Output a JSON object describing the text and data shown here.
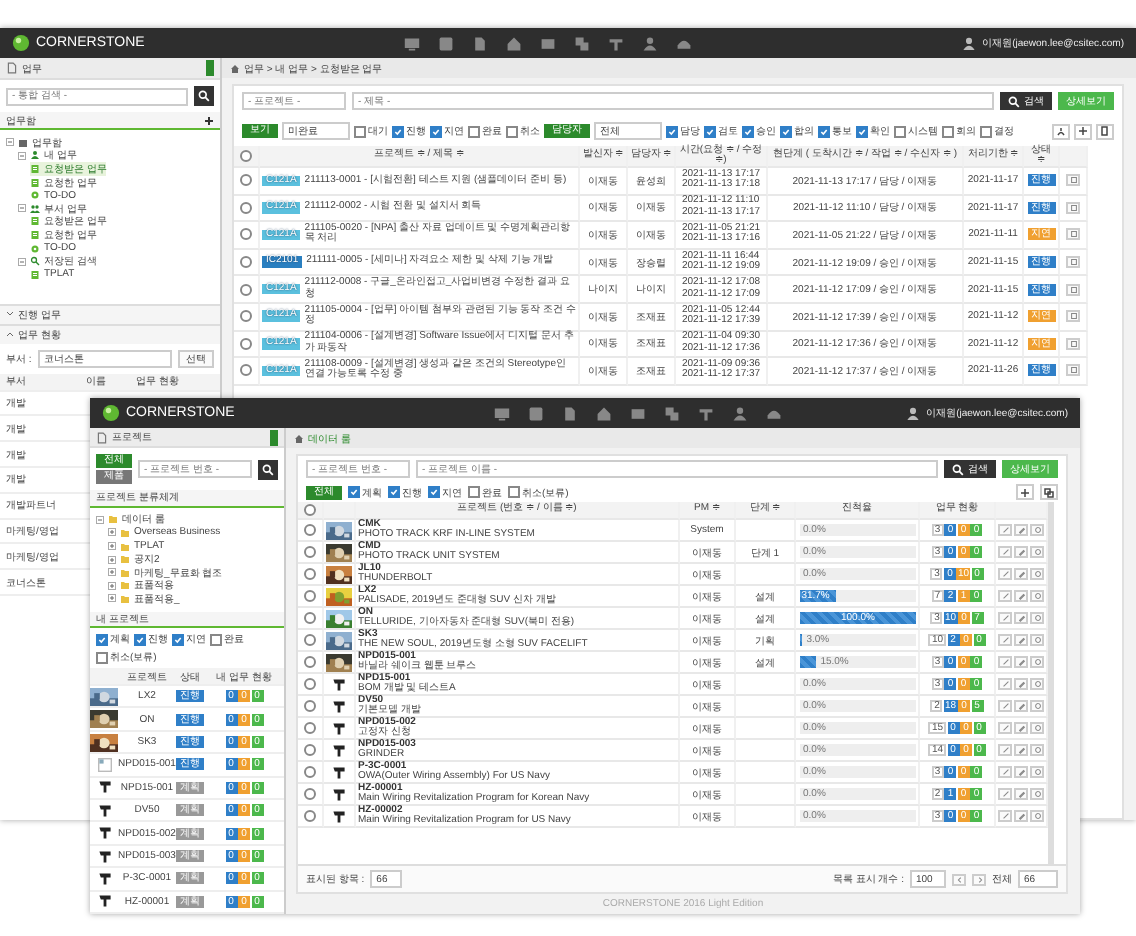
{
  "back_window": {
    "header": {
      "logo": "CORNERSTONE",
      "user": "이재원(jaewon.lee@csitec.com)"
    },
    "sidebar": {
      "title": "업무",
      "search": {
        "placeholder": "- 통합 검색 -"
      },
      "section": "업무함",
      "tree": [
        {
          "label": "업무함",
          "kind": "root",
          "selected": false,
          "expanded": true,
          "children": [
            {
              "label": "내 업무",
              "kind": "user",
              "selected": false,
              "expanded": true,
              "children": [
                {
                  "label": "요청받은 업무",
                  "kind": "doc",
                  "selected": true
                },
                {
                  "label": "요청한 업무",
                  "kind": "doc",
                  "selected": false
                },
                {
                  "label": "TO-DO",
                  "kind": "todo",
                  "selected": false
                }
              ]
            },
            {
              "label": "부서 업무",
              "kind": "group",
              "selected": false,
              "expanded": true,
              "children": [
                {
                  "label": "요청받은 업무",
                  "kind": "doc",
                  "selected": false
                },
                {
                  "label": "요청한 업무",
                  "kind": "doc",
                  "selected": false
                },
                {
                  "label": "TO-DO",
                  "kind": "todo",
                  "selected": false
                }
              ]
            },
            {
              "label": "저장된 검색",
              "kind": "search",
              "selected": false,
              "expanded": true,
              "children": [
                {
                  "label": "TPLAT",
                  "kind": "doc",
                  "selected": false
                }
              ]
            }
          ]
        }
      ],
      "panels": [
        {
          "label": "진행 업무",
          "expanded": false
        },
        {
          "label": "업무 현황",
          "expanded": true
        }
      ],
      "dept_label": "부서 :",
      "dept_value": "코너스톤",
      "select_button": "선택",
      "columns": [
        "부서",
        "이름",
        "업무 현황"
      ],
      "rows": [
        "개발",
        "개발",
        "개발",
        "개발",
        "개발파트너",
        "마케팅/영업",
        "마케팅/영업",
        "코너스톤"
      ]
    },
    "breadcrumb": "업무 > 내 업무 > 요청받은 업무",
    "filters": {
      "project_placeholder": "- 프로젝트 -",
      "title_placeholder": "- 제목 -",
      "search_button": "검색",
      "detail_button": "상세보기",
      "view_button": "보기",
      "scope_select": "미완료",
      "role_button": "담당자",
      "role_select": "전체",
      "status": [
        {
          "label": "대기",
          "checked": false
        },
        {
          "label": "진행",
          "checked": true
        },
        {
          "label": "지연",
          "checked": true
        },
        {
          "label": "완료",
          "checked": false
        },
        {
          "label": "취소",
          "checked": false
        }
      ],
      "roles": [
        {
          "label": "담당",
          "checked": true
        },
        {
          "label": "검토",
          "checked": true
        },
        {
          "label": "승인",
          "checked": true
        },
        {
          "label": "합의",
          "checked": true
        },
        {
          "label": "통보",
          "checked": true
        },
        {
          "label": "확인",
          "checked": true
        },
        {
          "label": "시스템",
          "checked": false
        },
        {
          "label": "회의",
          "checked": false
        },
        {
          "label": "결정",
          "checked": false
        }
      ]
    },
    "table": {
      "all_selected": false,
      "columns": [
        "프로젝트 ≑ / 제목 ≑",
        "발신자 ≑",
        "담당자 ≑",
        "시간(요청 ≑ / 수정 ≑)",
        "현단계 ( 도착시간 ≑ / 작업 ≑ / 수신자 ≑ )",
        "처리기한 ≑",
        "상태 ≑"
      ],
      "rows": [
        {
          "selected": false,
          "tag": {
            "label": "C121A",
            "color": "#5bc0de"
          },
          "title": "211113-0001 - [시험전환] 테스트 지원 (샘플데이터 준비 등)",
          "sender": "이재동",
          "assignee": "윤성희",
          "time": [
            "2021-11-13 17:17",
            "2021-11-13 17:18"
          ],
          "stage": "2021-11-13 17:17 / 담당 / 이재동",
          "due": "2021-11-17",
          "status": {
            "label": "진행",
            "color": "#2f7fc8"
          }
        },
        {
          "selected": false,
          "tag": {
            "label": "C121A",
            "color": "#5bc0de"
          },
          "title": "211112-0002 - 시험 전환 및 설치서 회득",
          "sender": "이재동",
          "assignee": "이재동",
          "time": [
            "2021-11-12 11:10",
            "2021-11-13 17:17"
          ],
          "stage": "2021-11-12 11:10 / 담당 / 이재동",
          "due": "2021-11-17",
          "status": {
            "label": "진행",
            "color": "#2f7fc8"
          }
        },
        {
          "selected": false,
          "tag": {
            "label": "C121A",
            "color": "#5bc0de"
          },
          "title": "211105-0020 - [NPA] 출산 자료 업데이트 및 수명계획관리항목 처리",
          "sender": "이재동",
          "assignee": "이재동",
          "time": [
            "2021-11-05 21:21",
            "2021-11-13 17:16"
          ],
          "stage": "2021-11-05 21:22 / 담당 / 이재동",
          "due": "2021-11-11",
          "status": {
            "label": "지연",
            "color": "#f0a030"
          }
        },
        {
          "selected": false,
          "tag": {
            "label": "IC2101",
            "color": "#2a7fc0"
          },
          "title": "211111-0005 - [세미나] 자격요소 제한 및 삭제 기능 개발",
          "sender": "이재동",
          "assignee": "장승렬",
          "time": [
            "2021-11-11 16:44",
            "2021-11-12 19:09"
          ],
          "stage": "2021-11-12 19:09 / 승인 / 이재동",
          "due": "2021-11-15",
          "status": {
            "label": "진행",
            "color": "#2f7fc8"
          }
        },
        {
          "selected": false,
          "tag": {
            "label": "C121A",
            "color": "#5bc0de"
          },
          "title": "211112-0008 - 구글_온라인접고_사업비변경 수정한 결과 요청",
          "sender": "나이지",
          "assignee": "나이지",
          "time": [
            "2021-11-12 17:08",
            "2021-11-12 17:09"
          ],
          "stage": "2021-11-12 17:09 / 승인 / 이재동",
          "due": "2021-11-15",
          "status": {
            "label": "진행",
            "color": "#2f7fc8"
          }
        },
        {
          "selected": false,
          "tag": {
            "label": "C121A",
            "color": "#5bc0de"
          },
          "title": "211105-0004 - [업무] 아이템 첨부와 관련된 기능 동작 조건 수정",
          "sender": "이재동",
          "assignee": "조재표",
          "time": [
            "2021-11-05 12:44",
            "2021-11-12 17:39"
          ],
          "stage": "2021-11-12 17:39 / 승인 / 이재동",
          "due": "2021-11-12",
          "status": {
            "label": "지연",
            "color": "#f0a030"
          }
        },
        {
          "selected": false,
          "tag": {
            "label": "C121A",
            "color": "#5bc0de"
          },
          "title": "211104-0006 - [설계변경] Software Issue에서 디지털 문서 추가 파동작",
          "sender": "이재동",
          "assignee": "조재표",
          "time": [
            "2021-11-04 09:30",
            "2021-11-12 17:36"
          ],
          "stage": "2021-11-12 17:36 / 승인 / 이재동",
          "due": "2021-11-12",
          "status": {
            "label": "지연",
            "color": "#f0a030"
          }
        },
        {
          "selected": false,
          "tag": {
            "label": "C121A",
            "color": "#5bc0de"
          },
          "title": "211108-0009 - [설계변경] 생성과 같은 조건의 Stereotype인 연결 가능토록 수정 중",
          "sender": "이재동",
          "assignee": "조재표",
          "time": [
            "2021-11-09 09:36",
            "2021-11-12 17:37"
          ],
          "stage": "2021-11-12 17:37 / 승인 / 이재동",
          "due": "2021-11-26",
          "status": {
            "label": "진행",
            "color": "#2f7fc8"
          }
        }
      ]
    }
  },
  "front_window": {
    "header": {
      "logo": "CORNERSTONE",
      "user": "이재원(jaewon.lee@csitec.com)"
    },
    "sidebar": {
      "title": "프로젝트",
      "all_button": "전체",
      "product_button": "제품",
      "search": {
        "placeholder": "- 프로젝트 번호 -"
      },
      "tree_title": "프로젝트 분류체계",
      "tree": [
        {
          "label": "데이터 룸",
          "expanded": true,
          "children": [
            {
              "label": "Overseas Business",
              "expanded": false
            },
            {
              "label": "TPLAT",
              "expanded": false
            },
            {
              "label": "공지2",
              "expanded": false
            },
            {
              "label": "마케팅_무료화 협조",
              "expanded": false
            },
            {
              "label": "표품적용",
              "expanded": false
            },
            {
              "label": "표품적용_",
              "expanded": false
            }
          ]
        }
      ],
      "my_title": "내 프로젝트",
      "status": [
        {
          "label": "계획",
          "checked": true
        },
        {
          "label": "진행",
          "checked": true
        },
        {
          "label": "지연",
          "checked": true
        },
        {
          "label": "완료",
          "checked": false
        },
        {
          "label": "취소(보류)",
          "checked": false
        }
      ],
      "columns": [
        "프로젝트",
        "상태",
        "내 업무 현황"
      ],
      "rows": [
        {
          "kind": "picture",
          "name": "LX2",
          "status": {
            "label": "진행",
            "color": "#2f7fc8"
          },
          "work": [
            "0",
            "0",
            "0"
          ]
        },
        {
          "kind": "picture",
          "name": "ON",
          "status": {
            "label": "진행",
            "color": "#2f7fc8"
          },
          "work": [
            "0",
            "0",
            "0"
          ]
        },
        {
          "kind": "picture",
          "name": "SK3",
          "status": {
            "label": "진행",
            "color": "#2f7fc8"
          },
          "work": [
            "0",
            "0",
            "0"
          ]
        },
        {
          "kind": "blank",
          "name": "NPD015-001",
          "status": {
            "label": "진행",
            "color": "#2f7fc8"
          },
          "work": [
            "0",
            "0",
            "0"
          ]
        },
        {
          "kind": "machine",
          "name": "NPD15-001",
          "status": {
            "label": "계획",
            "color": "#999999"
          },
          "work": [
            "0",
            "0",
            "0"
          ]
        },
        {
          "kind": "machine",
          "name": "DV50",
          "status": {
            "label": "계획",
            "color": "#999999"
          },
          "work": [
            "0",
            "0",
            "0"
          ]
        },
        {
          "kind": "machine",
          "name": "NPD015-002",
          "status": {
            "label": "계획",
            "color": "#999999"
          },
          "work": [
            "0",
            "0",
            "0"
          ]
        },
        {
          "kind": "machine",
          "name": "NPD015-003",
          "status": {
            "label": "계획",
            "color": "#999999"
          },
          "work": [
            "0",
            "0",
            "0"
          ]
        },
        {
          "kind": "machine",
          "name": "P-3C-0001",
          "status": {
            "label": "계획",
            "color": "#999999"
          },
          "work": [
            "0",
            "0",
            "0"
          ]
        },
        {
          "kind": "machine",
          "name": "HZ-00001",
          "status": {
            "label": "계획",
            "color": "#999999"
          },
          "work": [
            "0",
            "0",
            "0"
          ]
        }
      ]
    },
    "breadcrumb": "데이터 룸",
    "filters": {
      "number_placeholder": "- 프로젝트 번호 -",
      "name_placeholder": "- 프로젝트 이름 -",
      "search_button": "검색",
      "detail_button": "상세보기",
      "all_button": "전체",
      "status": [
        {
          "label": "계획",
          "checked": true
        },
        {
          "label": "진행",
          "checked": true
        },
        {
          "label": "지연",
          "checked": true
        },
        {
          "label": "완료",
          "checked": false
        },
        {
          "label": "취소(보류)",
          "checked": false
        }
      ]
    },
    "table": {
      "all_selected": false,
      "columns": [
        "프로젝트 (번호 ≑ / 이름 ≑)",
        "PM ≑",
        "단계 ≑",
        "진척율",
        "업무 현황"
      ],
      "rows": [
        {
          "selected": false,
          "kind": "picture",
          "number": "CMK",
          "name": "PHOTO TRACK KRF IN-LINE SYSTEM",
          "pm": "System",
          "stage": "",
          "reading": "0.0%",
          "work": [
            "3",
            "0",
            "0",
            "0"
          ]
        },
        {
          "selected": false,
          "kind": "picture",
          "number": "CMD",
          "name": "PHOTO TRACK UNIT SYSTEM",
          "pm": "이재동",
          "stage": "단계 1",
          "reading": "0.0%",
          "work": [
            "3",
            "0",
            "0",
            "0"
          ]
        },
        {
          "selected": false,
          "kind": "picture",
          "number": "JL10",
          "name": "THUNDERBOLT",
          "pm": "이재동",
          "stage": "",
          "reading": "0.0%",
          "work": [
            "3",
            "0",
            "10",
            "0"
          ]
        },
        {
          "selected": false,
          "kind": "picture",
          "number": "LX2",
          "name": "PALISADE, 2019년도 준대형 SUV 신차 개발",
          "pm": "이재동",
          "stage": "설계",
          "level": 0.317,
          "reading": "31.7%",
          "work": [
            "7",
            "2",
            "1",
            "0"
          ]
        },
        {
          "selected": false,
          "kind": "picture",
          "number": "ON",
          "name": "TELLURIDE, 기아자동차 준대형 SUV(북미 전용)",
          "pm": "이재동",
          "stage": "설계",
          "level": 1,
          "reading": "100.0%",
          "work": [
            "3",
            "10",
            "0",
            "7"
          ]
        },
        {
          "selected": false,
          "kind": "picture",
          "number": "SK3",
          "name": "THE NEW SOUL, 2019년도형 소형 SUV FACELIFT",
          "pm": "이재동",
          "stage": "기획",
          "level": 0.03,
          "reading": "3.0%",
          "work": [
            "10",
            "2",
            "0",
            "0"
          ]
        },
        {
          "selected": false,
          "kind": "picture",
          "number": "NPD015-001",
          "name": "바닐라 쉐이크 웹툰 브루스",
          "pm": "이재동",
          "stage": "설계",
          "level": 0.15,
          "reading": "15.0%",
          "work": [
            "3",
            "0",
            "0",
            "0"
          ]
        },
        {
          "selected": false,
          "kind": "machine",
          "number": "NPD15-001",
          "name": "BOM 개발 및 테스트A",
          "pm": "이재동",
          "stage": "",
          "reading": "0.0%",
          "work": [
            "3",
            "0",
            "0",
            "0"
          ]
        },
        {
          "selected": false,
          "kind": "machine",
          "number": "DV50",
          "name": "기본모델 개발",
          "pm": "이재동",
          "stage": "",
          "reading": "0.0%",
          "work": [
            "2",
            "18",
            "0",
            "5"
          ]
        },
        {
          "selected": false,
          "kind": "machine",
          "number": "NPD015-002",
          "name": "고정자 신청",
          "pm": "이재동",
          "stage": "",
          "reading": "0.0%",
          "work": [
            "15",
            "0",
            "0",
            "0"
          ]
        },
        {
          "selected": false,
          "kind": "machine",
          "number": "NPD015-003",
          "name": "GRINDER",
          "pm": "이재동",
          "stage": "",
          "reading": "0.0%",
          "work": [
            "14",
            "0",
            "0",
            "0"
          ]
        },
        {
          "selected": false,
          "kind": "machine",
          "number": "P-3C-0001",
          "name": "OWA(Outer Wiring Assembly) For US Navy",
          "pm": "이재동",
          "stage": "",
          "reading": "0.0%",
          "work": [
            "3",
            "0",
            "0",
            "0"
          ]
        },
        {
          "selected": false,
          "kind": "machine",
          "number": "HZ-00001",
          "name": "Main Wiring Revitalization Program for Korean Navy",
          "pm": "이재동",
          "stage": "",
          "reading": "0.0%",
          "work": [
            "2",
            "1",
            "0",
            "0"
          ]
        },
        {
          "selected": false,
          "kind": "machine",
          "number": "HZ-00002",
          "name": "Main Wiring Revitalization Program for US Navy",
          "pm": "이재동",
          "stage": "",
          "reading": "0.0%",
          "work": [
            "3",
            "0",
            "0",
            "0"
          ]
        }
      ]
    },
    "footer": {
      "shown_label": "표시된 항목 :",
      "shown_value": "66",
      "page_size_label": "목록 표시 개수 :",
      "page_size": "100",
      "total_label": "전체",
      "total": "66"
    },
    "copyright": "CORNERSTONE 2016 Light Edition"
  }
}
